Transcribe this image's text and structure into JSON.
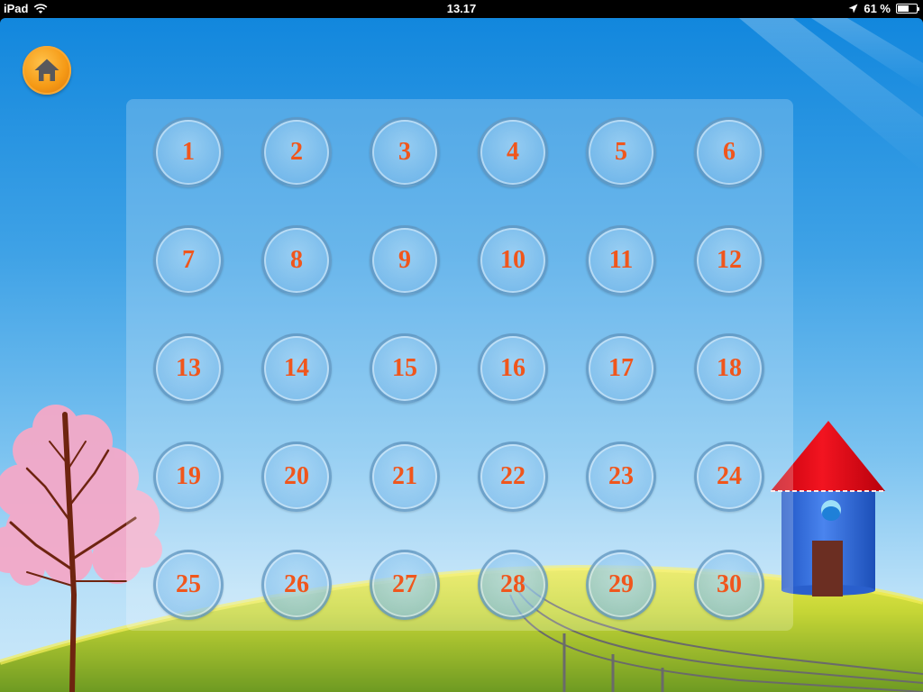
{
  "status_bar": {
    "device": "iPad",
    "time": "13.17",
    "battery": "61 %",
    "battery_level": 0.61,
    "icons": [
      "wifi-icon",
      "location-arrow-icon",
      "battery-icon"
    ]
  },
  "toolbar": {
    "home_icon": "home-icon",
    "home_color": "#f59a16"
  },
  "levels": {
    "items": [
      "1",
      "2",
      "3",
      "4",
      "5",
      "6",
      "7",
      "8",
      "9",
      "10",
      "11",
      "12",
      "13",
      "14",
      "15",
      "16",
      "17",
      "18",
      "19",
      "20",
      "21",
      "22",
      "23",
      "24",
      "25",
      "26",
      "27",
      "28",
      "29",
      "30"
    ],
    "number_color": "#f0561c"
  },
  "colors": {
    "sky_top": "#1287dd",
    "sky_bottom": "#cde9fa",
    "hill": "#a8c82a",
    "roof": "#e8121a",
    "tower": "#3a6fd8",
    "blossom": "#f4a9c8"
  }
}
